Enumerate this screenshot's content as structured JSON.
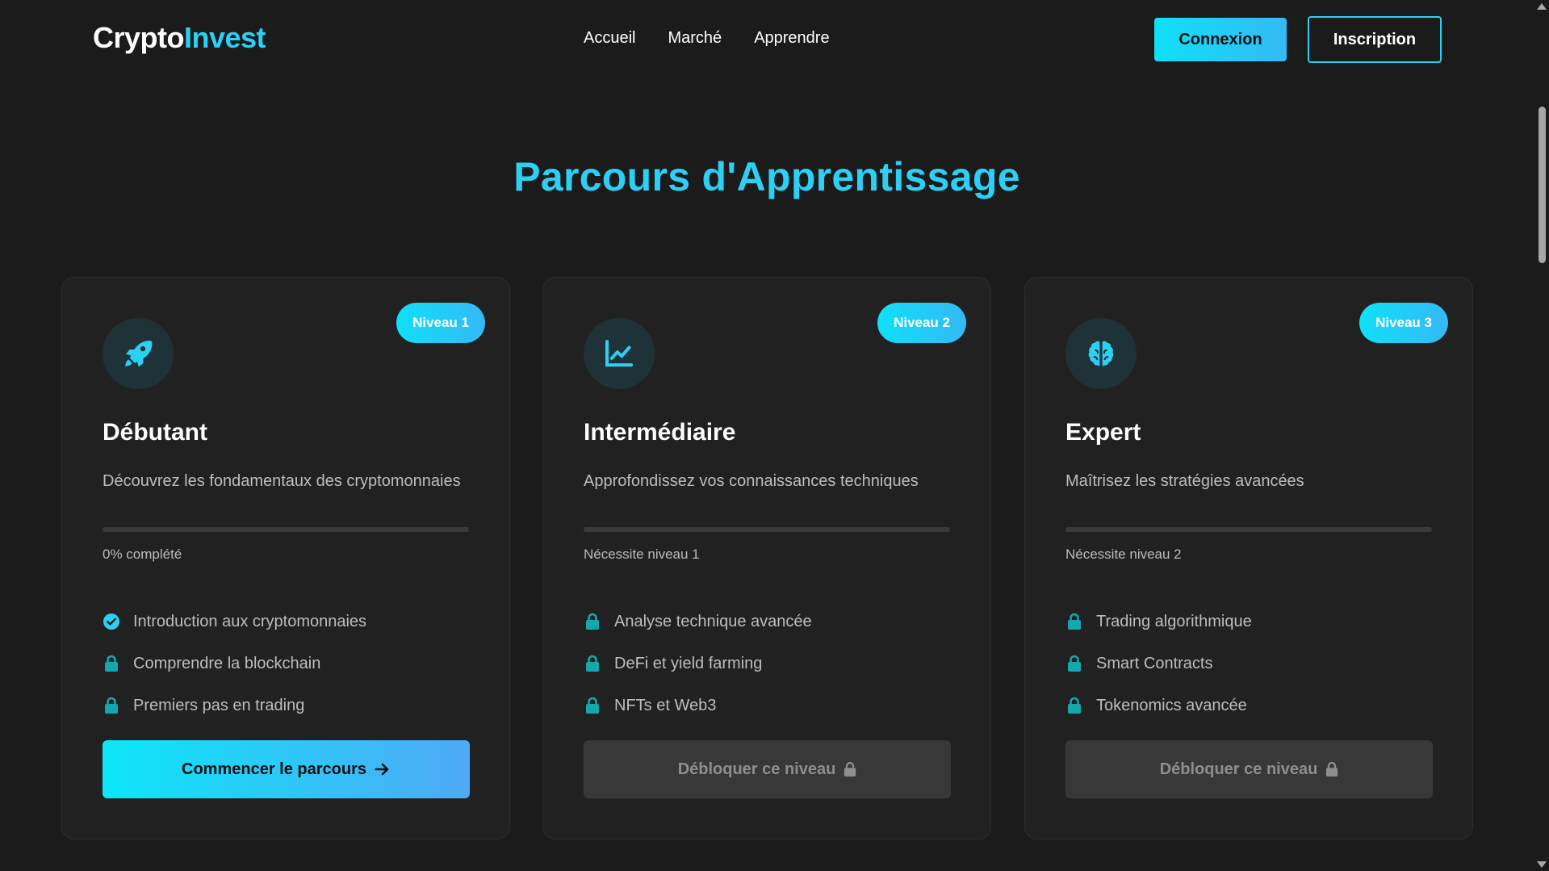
{
  "brand": {
    "part1": "Crypto",
    "part2": "Invest"
  },
  "nav": {
    "links": [
      "Accueil",
      "Marché",
      "Apprendre"
    ]
  },
  "auth": {
    "login": "Connexion",
    "signup": "Inscription"
  },
  "section": {
    "title": "Parcours d'Apprentissage"
  },
  "colors": {
    "accent": "#2cd0f5",
    "background": "#1b1b1b",
    "card": "#212121",
    "lock": "#14a7ac"
  },
  "cards": [
    {
      "badge": "Niveau 1",
      "icon": "rocket-icon",
      "title": "Débutant",
      "description": "Découvrez les fondamentaux des cryptomonnaies",
      "progress_percent": 0,
      "status": "0% complété",
      "modules": [
        {
          "label": "Introduction aux cryptomonnaies",
          "state": "available"
        },
        {
          "label": "Comprendre la blockchain",
          "state": "locked"
        },
        {
          "label": "Premiers pas en trading",
          "state": "locked"
        }
      ],
      "cta": "Commencer le parcours"
    },
    {
      "badge": "Niveau 2",
      "icon": "chart-line-icon",
      "title": "Intermédiaire",
      "description": "Approfondissez vos connaissances techniques",
      "progress_percent": 0,
      "status": "Nécessite niveau 1",
      "modules": [
        {
          "label": "Analyse technique avancée",
          "state": "locked"
        },
        {
          "label": "DeFi et yield farming",
          "state": "locked"
        },
        {
          "label": "NFTs et Web3",
          "state": "locked"
        }
      ],
      "cta": "Débloquer ce niveau"
    },
    {
      "badge": "Niveau 3",
      "icon": "brain-icon",
      "title": "Expert",
      "description": "Maîtrisez les stratégies avancées",
      "progress_percent": 0,
      "status": "Nécessite niveau 2",
      "modules": [
        {
          "label": "Trading algorithmique",
          "state": "locked"
        },
        {
          "label": "Smart Contracts",
          "state": "locked"
        },
        {
          "label": "Tokenomics avancée",
          "state": "locked"
        }
      ],
      "cta": "Débloquer ce niveau"
    }
  ]
}
